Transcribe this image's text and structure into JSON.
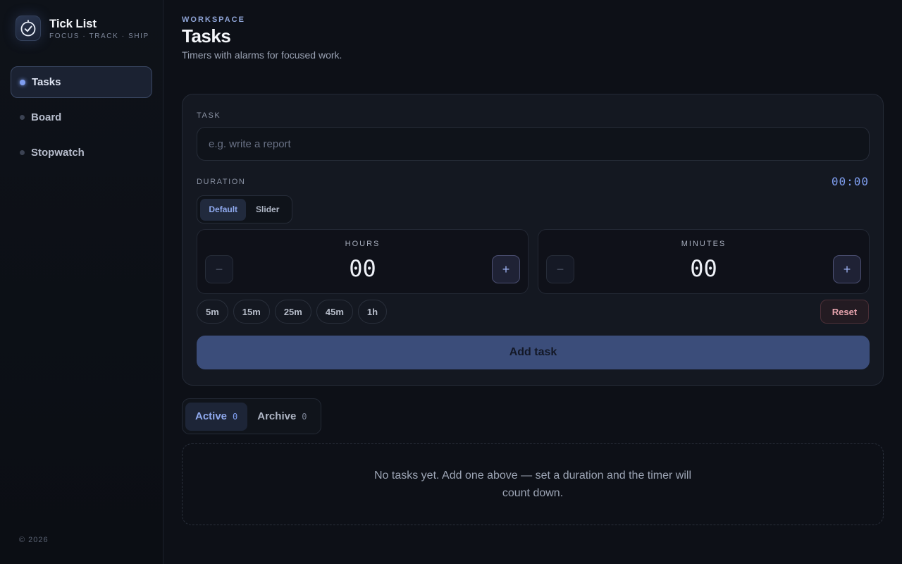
{
  "brand": {
    "title": "Tick List",
    "subtitle": "FOCUS · TRACK · SHIP"
  },
  "sidebar": {
    "items": [
      {
        "label": "Tasks",
        "active": true
      },
      {
        "label": "Board",
        "active": false
      },
      {
        "label": "Stopwatch",
        "active": false
      }
    ],
    "copyright": "© 2026"
  },
  "header": {
    "eyebrow": "WORKSPACE",
    "title": "Tasks",
    "subtitle": "Timers with alarms for focused work."
  },
  "form": {
    "task_label": "TASK",
    "task_placeholder": "e.g. write a report",
    "duration_label": "DURATION",
    "duration_readout": "00:00",
    "modes": {
      "default": "Default",
      "slider": "Slider",
      "selected": "Default"
    },
    "hours": {
      "label": "HOURS",
      "value": "00",
      "minus": "−",
      "plus": "+"
    },
    "minutes": {
      "label": "MINUTES",
      "value": "00",
      "minus": "−",
      "plus": "+"
    },
    "presets": [
      "5m",
      "15m",
      "25m",
      "45m",
      "1h"
    ],
    "reset_label": "Reset",
    "submit_label": "Add task"
  },
  "tabs": [
    {
      "label": "Active",
      "count": "0",
      "active": true
    },
    {
      "label": "Archive",
      "count": "0",
      "active": false
    }
  ],
  "empty_state": "No tasks yet. Add one above — set a duration and the timer will count down.",
  "colors": {
    "accent": "#7f9ef0",
    "danger": "#e6a3ad",
    "primary_button": "#3b4d7a"
  }
}
